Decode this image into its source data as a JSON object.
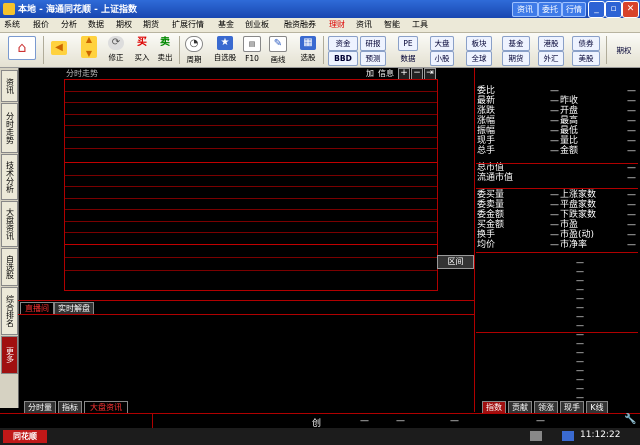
{
  "titlebar": {
    "title": "本地 - 海通同花顺 - 上证指数",
    "buttons": [
      "资讯",
      "委托",
      "行情"
    ]
  },
  "menu": [
    "系统",
    "报价",
    "分析",
    "数据",
    "期权",
    "期货",
    "扩展行情",
    "基金",
    "创业板",
    "融资融券",
    "理财",
    "资讯",
    "智能",
    "工具"
  ],
  "toolbar": {
    "tools": [
      {
        "label": "",
        "icon": "home-icon"
      },
      {
        "label": "",
        "icon": "back-icon"
      },
      {
        "label": "",
        "icon": "updown-icon"
      },
      {
        "label": "修正",
        "icon": "fix-icon"
      },
      {
        "label": "买入",
        "icon": "buy-icon",
        "glyph": "买"
      },
      {
        "label": "卖出",
        "icon": "sell-icon",
        "glyph": "卖"
      },
      {
        "label": "周期",
        "icon": "clock-icon"
      },
      {
        "label": "自选股",
        "icon": "star-icon"
      },
      {
        "label": "F10",
        "icon": "f10-icon"
      },
      {
        "label": "画线",
        "icon": "pen-icon"
      },
      {
        "label": "选股",
        "icon": "select-icon"
      }
    ],
    "small_buttons": [
      "资金",
      "研报",
      "PE",
      "大盘",
      "板块",
      "基金",
      "港股",
      "债券",
      "BBD",
      "预测",
      "数据",
      "小股",
      "全球",
      "期货",
      "外汇",
      "美股"
    ],
    "right": "期权"
  },
  "left_tabs": [
    "资讯",
    "分时走势",
    "技术分析",
    "大盘资讯",
    "自选股",
    "综合排名",
    "更多"
  ],
  "chart": {
    "title": "分时走势",
    "controls": [
      "加",
      "信息"
    ],
    "range_button": "区间"
  },
  "quote_rows": [
    {
      "a": "委比",
      "d": "—",
      "b": "",
      "e": "—"
    },
    {
      "a": "最新",
      "d": "—",
      "b": "昨收",
      "e": "—"
    },
    {
      "a": "涨跌",
      "d": "—",
      "b": "开盘",
      "e": "—"
    },
    {
      "a": "涨幅",
      "d": "—",
      "b": "最高",
      "e": "—"
    },
    {
      "a": "振幅",
      "d": "—",
      "b": "最低",
      "e": "—"
    },
    {
      "a": "现手",
      "d": "—",
      "b": "量比",
      "e": "—"
    },
    {
      "a": "总手",
      "d": "—",
      "b": "金额",
      "e": "—"
    },
    {
      "a": "总市值",
      "d": "",
      "b": "",
      "e": "—"
    },
    {
      "a": "流通市值",
      "d": "",
      "b": "",
      "e": "—"
    },
    {
      "a": "委买量",
      "d": "—",
      "b": "上涨家数",
      "e": "—"
    },
    {
      "a": "委卖量",
      "d": "—",
      "b": "平盘家数",
      "e": "—"
    },
    {
      "a": "委金额",
      "d": "—",
      "b": "下跌家数",
      "e": "—"
    },
    {
      "a": "买金额",
      "d": "—",
      "b": "市盈",
      "e": "—"
    },
    {
      "a": "换手",
      "d": "—",
      "b": "市盈(动)",
      "e": "—"
    },
    {
      "a": "均价",
      "d": "—",
      "b": "市净率",
      "e": "—"
    }
  ],
  "dash_rows": [
    "—",
    "—",
    "—",
    "—",
    "—",
    "—",
    "—",
    "—",
    "—",
    "—",
    "—",
    "—",
    "—",
    "—",
    "—",
    "—"
  ],
  "lower_tabs": [
    "直播间",
    "实时解盘"
  ],
  "bottom_left_tabs": [
    "分时量",
    "指标",
    "大盘资讯"
  ],
  "bottom_right_tabs": [
    "指数",
    "贡献",
    "领涨",
    "现手",
    "K线"
  ],
  "status": {
    "chuang": "创",
    "dashes": [
      "—",
      "—",
      "—",
      "—"
    ]
  },
  "taskbar": {
    "logo": "同花顺",
    "time": "11:12:22"
  }
}
